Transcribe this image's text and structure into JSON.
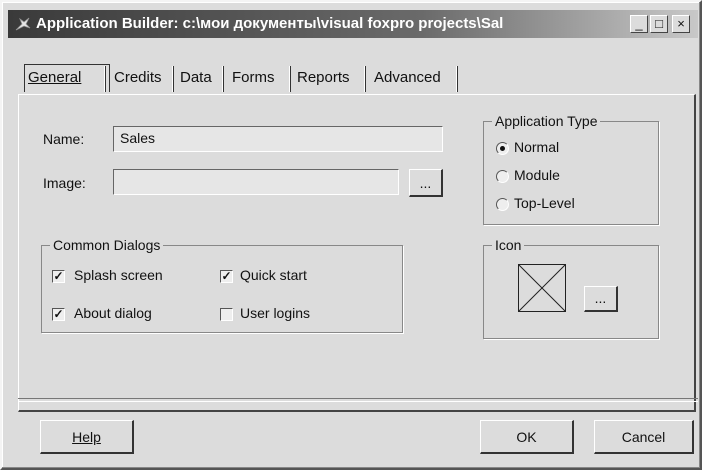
{
  "window": {
    "title": "Application Builder: c:\\мои документы\\visual foxpro projects\\Sal",
    "controls": {
      "minimize": "_",
      "maximize": "□",
      "close": "×"
    }
  },
  "tabs": [
    {
      "label": "General",
      "active": true
    },
    {
      "label": "Credits"
    },
    {
      "label": "Data"
    },
    {
      "label": "Forms"
    },
    {
      "label": "Reports"
    },
    {
      "label": "Advanced"
    }
  ],
  "general": {
    "name_label": "Name:",
    "name_value": "Sales",
    "image_label": "Image:",
    "image_value": "",
    "browse_label": "...",
    "app_type": {
      "title": "Application Type",
      "options": [
        {
          "label": "Normal",
          "selected": true
        },
        {
          "label": "Module",
          "selected": false
        },
        {
          "label": "Top-Level",
          "selected": false
        }
      ]
    },
    "common_dialogs": {
      "title": "Common Dialogs",
      "items": [
        {
          "label": "Splash screen",
          "checked": true
        },
        {
          "label": "Quick start",
          "checked": true
        },
        {
          "label": "About dialog",
          "checked": true
        },
        {
          "label": "User logins",
          "checked": false
        }
      ]
    },
    "icon_group": {
      "title": "Icon",
      "browse_label": "..."
    }
  },
  "buttons": {
    "help": "Help",
    "ok": "OK",
    "cancel": "Cancel"
  },
  "check_mark": "✓"
}
